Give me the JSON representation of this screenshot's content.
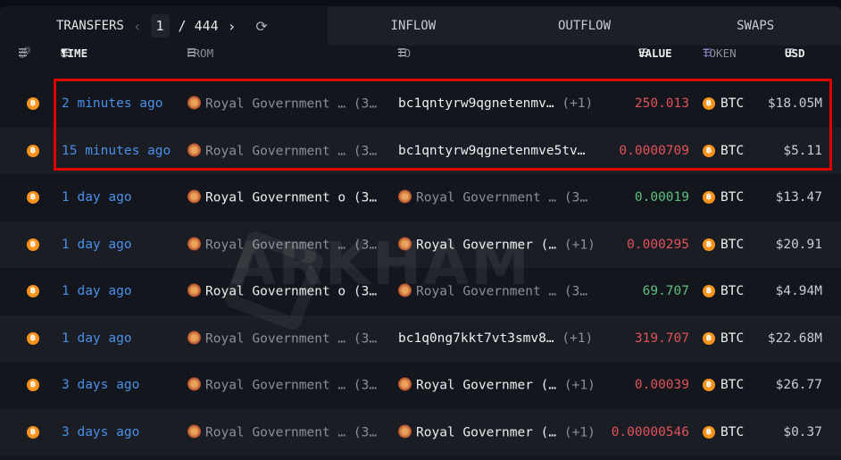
{
  "tabs": {
    "transfers": "TRANSFERS",
    "page_current": "1",
    "page_total": "/ 444",
    "inflow": "INFLOW",
    "outflow": "OUTFLOW",
    "swaps": "SWAPS"
  },
  "columns": {
    "time": "TIME",
    "from": "FROM",
    "to": "TO",
    "value": "VALUE",
    "token": "TOKEN",
    "usd": "USD"
  },
  "watermark": "ARKHAM",
  "rows": [
    {
      "time": "2 minutes ago",
      "from": "Royal Government … (3…",
      "from_style": "gray",
      "from_seal": true,
      "to": "bc1qntyrw9qgnetenmv…",
      "to_extra": "(+1)",
      "to_style": "white",
      "to_seal": false,
      "value": "250.013",
      "value_color": "red",
      "token": "BTC",
      "usd": "$18.05M"
    },
    {
      "time": "15 minutes ago",
      "from": "Royal Government … (3…",
      "from_style": "gray",
      "from_seal": true,
      "to": "bc1qntyrw9qgnetenmve5tv…",
      "to_extra": "",
      "to_style": "white",
      "to_seal": false,
      "value": "0.0000709",
      "value_color": "red",
      "token": "BTC",
      "usd": "$5.11"
    },
    {
      "time": "1 day ago",
      "from": "Royal Government o (3…",
      "from_style": "white",
      "from_seal": true,
      "to": "Royal Government … (3…",
      "to_extra": "",
      "to_style": "gray",
      "to_seal": true,
      "value": "0.00019",
      "value_color": "green",
      "token": "BTC",
      "usd": "$13.47"
    },
    {
      "time": "1 day ago",
      "from": "Royal Government … (3…",
      "from_style": "gray",
      "from_seal": true,
      "to": "Royal Governmer (…",
      "to_extra": "(+1)",
      "to_style": "white",
      "to_seal": true,
      "value": "0.000295",
      "value_color": "red",
      "token": "BTC",
      "usd": "$20.91"
    },
    {
      "time": "1 day ago",
      "from": "Royal Government o (3…",
      "from_style": "white",
      "from_seal": true,
      "to": "Royal Government … (3…",
      "to_extra": "",
      "to_style": "gray",
      "to_seal": true,
      "value": "69.707",
      "value_color": "green",
      "token": "BTC",
      "usd": "$4.94M"
    },
    {
      "time": "1 day ago",
      "from": "Royal Government … (3…",
      "from_style": "gray",
      "from_seal": true,
      "to": "bc1q0ng7kkt7vt3smv8…",
      "to_extra": "(+1)",
      "to_style": "white",
      "to_seal": false,
      "value": "319.707",
      "value_color": "red",
      "token": "BTC",
      "usd": "$22.68M"
    },
    {
      "time": "3 days ago",
      "from": "Royal Government … (3…",
      "from_style": "gray",
      "from_seal": true,
      "to": "Royal Governmer (…",
      "to_extra": "(+1)",
      "to_style": "white",
      "to_seal": true,
      "value": "0.00039",
      "value_color": "red",
      "token": "BTC",
      "usd": "$26.77"
    },
    {
      "time": "3 days ago",
      "from": "Royal Government … (3…",
      "from_style": "gray",
      "from_seal": true,
      "to": "Royal Governmer (…",
      "to_extra": "(+1)",
      "to_style": "white",
      "to_seal": true,
      "value": "0.00000546",
      "value_color": "red",
      "token": "BTC",
      "usd": "$0.37"
    }
  ]
}
